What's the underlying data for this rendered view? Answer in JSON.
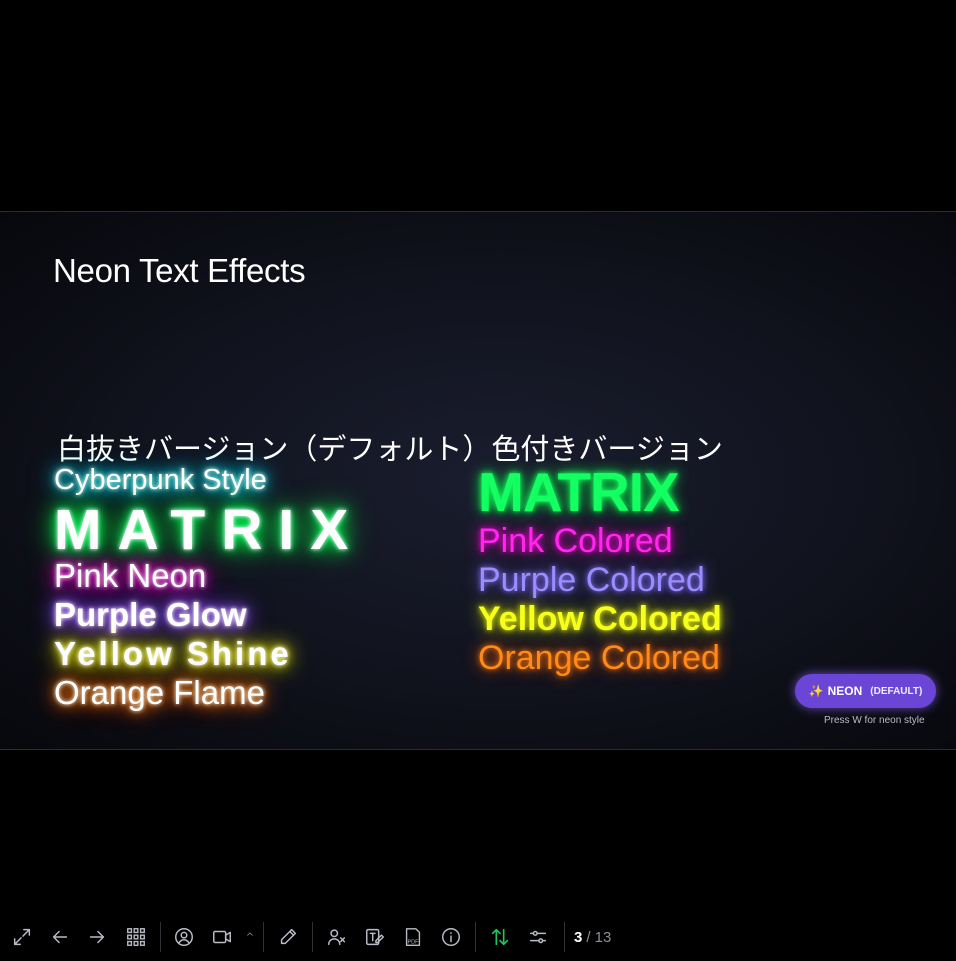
{
  "slide": {
    "title": "Neon Text Effects",
    "column_headers": {
      "left": "白抜きバージョン（デフォルト）",
      "right": "色付きバージョン"
    },
    "left_samples": [
      "Cyberpunk Style",
      "MATRIX",
      "Pink Neon",
      "Purple Glow",
      "Yellow Shine",
      "Orange Flame"
    ],
    "right_samples": [
      "MATRIX",
      "Pink Colored",
      "Purple Colored",
      "Yellow Colored",
      "Orange Colored"
    ],
    "badge": {
      "icon": "sparkles-icon",
      "label": "NEON",
      "sublabel": "(DEFAULT)"
    },
    "hint": "Press W for neon style",
    "colors": {
      "background": "#000000",
      "badge": "#6b45d6",
      "cyan": "#00fff0",
      "green": "#14ff62",
      "pink": "#ff27ee",
      "purple": "#9b8cff",
      "yellow": "#f7ff1c",
      "orange": "#ff8a1a"
    }
  },
  "toolbar": {
    "buttons": [
      {
        "name": "fullscreen-icon"
      },
      {
        "name": "arrow-left-icon"
      },
      {
        "name": "arrow-right-icon"
      },
      {
        "name": "grid-icon"
      },
      {
        "name": "user-circle-icon"
      },
      {
        "name": "camera-icon"
      },
      {
        "name": "pen-icon"
      },
      {
        "name": "presenter-icon"
      },
      {
        "name": "text-edit-icon"
      },
      {
        "name": "pdf-icon"
      },
      {
        "name": "info-icon"
      },
      {
        "name": "swap-vertical-icon"
      },
      {
        "name": "sliders-icon"
      }
    ],
    "page": {
      "current": "3",
      "separator_total": "/ 13"
    },
    "colors": {
      "icon": "#b9bcc6",
      "active": "#22c55e"
    }
  }
}
